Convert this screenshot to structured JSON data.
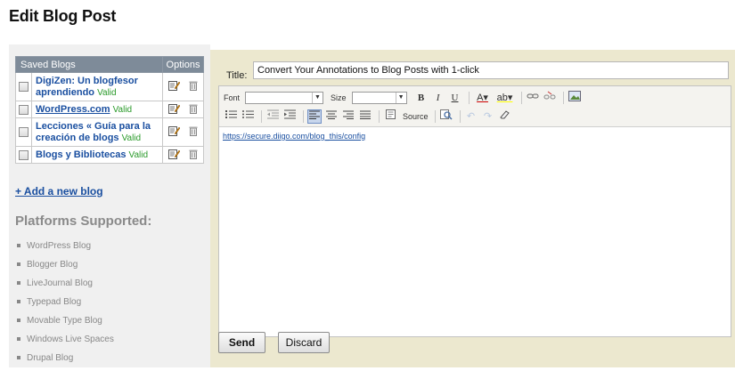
{
  "page": {
    "title": "Edit Blog Post"
  },
  "saved_blogs": {
    "header_name": "Saved Blogs",
    "header_options": "Options",
    "rows": [
      {
        "line1": "DigiZen: Un blogfesor",
        "line2": "aprendiendo",
        "status": "Valid"
      },
      {
        "line1": "WordPress.com",
        "line2": "",
        "status": "Valid"
      },
      {
        "line1": "Lecciones « Guía para la",
        "line2": "creación de blogs",
        "status": "Valid"
      },
      {
        "line1": "Blogs y Bibliotecas",
        "line2": "",
        "status": "Valid"
      }
    ]
  },
  "add_blog_label": "+ Add a new blog",
  "platforms": {
    "title": "Platforms Supported:",
    "items": [
      "WordPress Blog",
      "Blogger Blog",
      "LiveJournal Blog",
      "Typepad Blog",
      "Movable Type Blog",
      "Windows Live Spaces",
      "Drupal Blog"
    ]
  },
  "editor": {
    "title_label": "Title:",
    "title_value": "Convert Your Annotations to Blog Posts with 1-click",
    "toolbar": {
      "font_label": "Font",
      "size_label": "Size",
      "source_label": "Source"
    },
    "content_link": "https://secure.diigo.com/blog_this/config"
  },
  "buttons": {
    "send": "Send",
    "discard": "Discard"
  }
}
